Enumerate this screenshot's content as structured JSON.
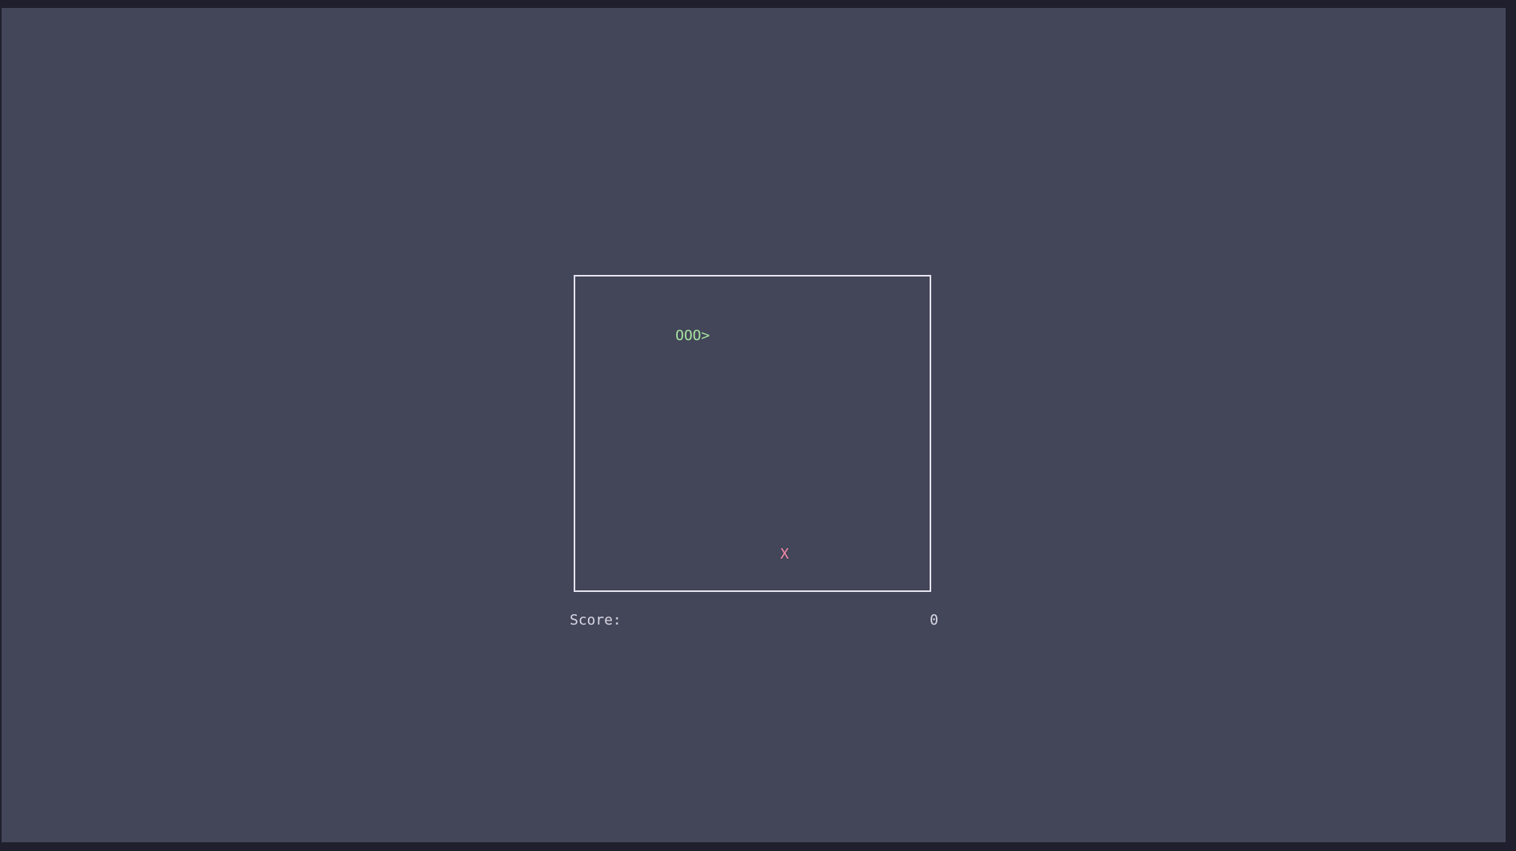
{
  "game": {
    "snake_text": "OOO>",
    "food_text": "X"
  },
  "score": {
    "label": "Score:",
    "value": "0"
  },
  "colors": {
    "background": "#434558",
    "frame": "#1f1f2d",
    "border": "#e4e4f0",
    "snake": "#a6e3a1",
    "food": "#f38ba8",
    "text": "#d8d8e6"
  }
}
